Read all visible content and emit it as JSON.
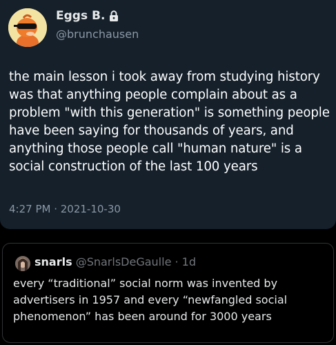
{
  "tweet": {
    "display_name": "Eggs B.",
    "handle": "@brunchausen",
    "text": "the main lesson i took away from studying history was that anything people complain about as a problem \"with this generation\" is something people have been saying for thousands of years, and anything those people call \"human nature\" is a social construction of the last 100 years",
    "timestamp": "4:27 PM · 2021-10-30",
    "avatar_icon": "cartoon-character-with-sunglasses",
    "lock_icon": "lock-icon"
  },
  "quote": {
    "display_name": "snarls",
    "handle": "@SnarlsDeGaulle",
    "separator": " · ",
    "age": "1d",
    "text": "every “traditional” social norm was invented by advertisers in 1957 and every “newfangled social phenomenon” has been around for 3000 years"
  },
  "colors": {
    "card_background": "#15202b",
    "page_background": "#000000",
    "secondary_text": "#8b98a5"
  }
}
